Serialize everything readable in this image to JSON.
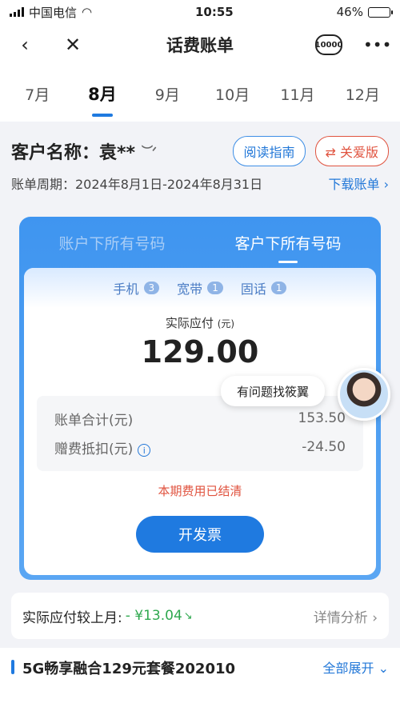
{
  "status": {
    "carrier": "中国电信",
    "time": "10:55",
    "battery": "46%",
    "battery_fraction": 0.46
  },
  "nav": {
    "title": "话费账单",
    "logo_text": "10000"
  },
  "months": [
    "7月",
    "8月",
    "9月",
    "10月",
    "11月",
    "12月"
  ],
  "active_month": "8月",
  "customer": {
    "label": "客户名称：袁**",
    "guide": "阅读指南",
    "care": "⇄ 关爱版"
  },
  "period": {
    "text": "账单周期：2024年8月1日-2024年8月31日",
    "download": "下载账单 ›"
  },
  "scope_tabs": [
    "账户下所有号码",
    "客户下所有号码"
  ],
  "chips": [
    {
      "label": "手机",
      "count": "3"
    },
    {
      "label": "宽带",
      "count": "1"
    },
    {
      "label": "固话",
      "count": "1"
    }
  ],
  "payment": {
    "label": "实际应付",
    "unit": "(元)",
    "amount": "129.00"
  },
  "summary": [
    {
      "label": "账单合计(元)",
      "value": "153.50"
    },
    {
      "label": "赠费抵扣(元)",
      "value": "-24.50"
    }
  ],
  "settled_text": "本期费用已结清",
  "invoice_button": "开发票",
  "tooltip": "有问题找筱翼",
  "compare": {
    "label": "实际应付较上月:",
    "diff": "- ¥13.04",
    "detail": "详情分析 ›"
  },
  "package": {
    "name": "5G畅享融合129元套餐202010",
    "expand": "全部展开 ⌄"
  },
  "colors": {
    "accent": "#1f7ae0",
    "warning": "#e0533f",
    "positive": "#2fa84f"
  }
}
